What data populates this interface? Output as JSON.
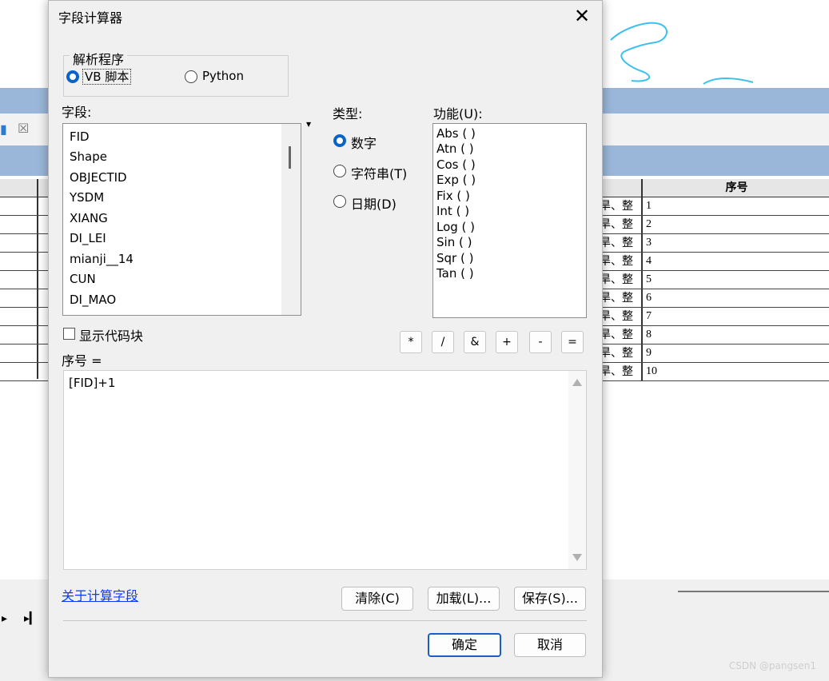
{
  "dialog": {
    "title": "字段计算器",
    "close_icon": "close-icon",
    "parser": {
      "label": "解析程序",
      "options": [
        {
          "label": "VB 脚本",
          "selected": true
        },
        {
          "label": "Python",
          "selected": false
        }
      ]
    },
    "fields": {
      "label": "字段:",
      "items": [
        "FID",
        "Shape",
        "OBJECTID",
        "YSDM",
        "XIANG",
        "DI_LEI",
        "mianji__14",
        "CUN",
        "DI_MAO"
      ]
    },
    "type": {
      "label": "类型:",
      "options": [
        {
          "label": "数字",
          "selected": true
        },
        {
          "label": "字符串(T)",
          "selected": false
        },
        {
          "label": "日期(D)",
          "selected": false
        }
      ]
    },
    "functions": {
      "label": "功能(U):",
      "items": [
        "Abs ( )",
        "Atn ( )",
        "Cos ( )",
        "Exp ( )",
        "Fix ( )",
        "Int ( )",
        "Log ( )",
        "Sin ( )",
        "Sqr ( )",
        "Tan ( )"
      ]
    },
    "show_codeblock": {
      "label": "显示代码块",
      "checked": false
    },
    "operators": [
      "*",
      "/",
      "&",
      "+",
      "-",
      "="
    ],
    "expression": {
      "label": "序号 =",
      "value": "[FID]+1"
    },
    "about_link": "关于计算字段",
    "buttons": {
      "clear": "清除(C)",
      "load": "加载(L)...",
      "save": "保存(S)...",
      "ok": "确定",
      "cancel": "取消"
    }
  },
  "background_table": {
    "header": "序号",
    "left_header": "",
    "rows": [
      {
        "left": "旱、整",
        "value": "1"
      },
      {
        "left": "旱、整",
        "value": "2"
      },
      {
        "left": "旱、整",
        "value": "3"
      },
      {
        "left": "旱、整",
        "value": "4"
      },
      {
        "left": "旱、整",
        "value": "5"
      },
      {
        "left": "旱、整",
        "value": "6"
      },
      {
        "left": "旱、整",
        "value": "7"
      },
      {
        "left": "旱、整",
        "value": "8"
      },
      {
        "left": "旱、整",
        "value": "9"
      },
      {
        "left": "旱、整",
        "value": "10"
      }
    ]
  },
  "watermark": "CSDN @pangsen1",
  "colors": {
    "accent": "#0a64c8",
    "app_titlebar": "#9ab7d9",
    "link": "#0a3cff"
  }
}
